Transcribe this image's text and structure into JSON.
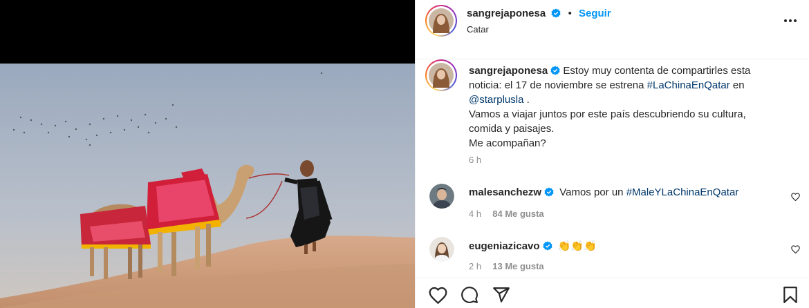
{
  "header": {
    "username": "sangrejaponesa",
    "separator": "•",
    "follow_label": "Seguir",
    "location": "Catar",
    "more_icon": "more-horizontal-icon"
  },
  "caption": {
    "username": "sangrejaponesa",
    "text_1": "Estoy muy contenta de compartirles esta noticia: el 17 de noviembre se estrena ",
    "hashtag": "#LaChinaEnQatar",
    "text_2": " en",
    "mention": "@starplusla",
    "text_3": " .",
    "line_2": "Vamos a viajar juntos por este país descubriendo su cultura, comida y paisajes.",
    "line_3": "Me acompañan?",
    "time": "6 h"
  },
  "comments": [
    {
      "username": "malesanchezw",
      "text": "Vamos por un ",
      "hashtag": "#MaleYLaChinaEnQatar",
      "time": "4 h",
      "likes": "84 Me gusta"
    },
    {
      "username": "eugeniazicavo",
      "text": "👏👏👏",
      "time": "2 h",
      "likes": "13 Me gusta"
    }
  ],
  "actions": {
    "like_icon": "heart-icon",
    "comment_icon": "comment-icon",
    "share_icon": "send-icon",
    "save_icon": "bookmark-icon"
  },
  "colors": {
    "accent": "#0095f6",
    "link": "#00376b",
    "verified": "#0095f6",
    "muted": "#8e8e8e",
    "text": "#262626"
  }
}
